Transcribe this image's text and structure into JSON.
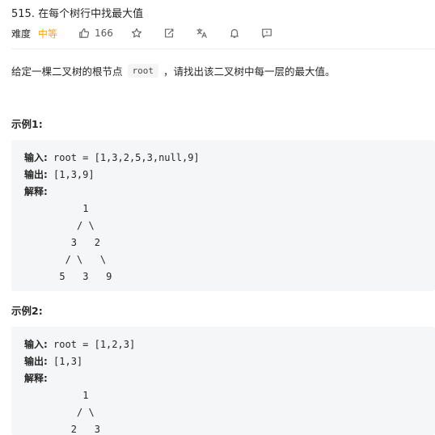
{
  "problem": {
    "title": "515. 在每个树行中找最大值",
    "difficulty_label": "难度",
    "difficulty_value": "中等",
    "like_count": "166"
  },
  "icons": {
    "like": "thumbs-up-icon",
    "favorite": "star-icon",
    "share": "share-icon",
    "translate": "translate-icon",
    "notify": "bell-icon",
    "feedback": "feedback-icon"
  },
  "description": {
    "prefix": "给定一棵二叉树的根节点",
    "code": "root",
    "suffix": "，请找出该二叉树中每一层的最大值。"
  },
  "examples": [
    {
      "title": "示例1:",
      "input_label": "输入:",
      "input_value": " root = [1,3,2,5,3,null,9]",
      "output_label": "输出:",
      "output_value": " [1,3,9]",
      "explain_label": "解释:",
      "tree": [
        "          1",
        "         / \\",
        "        3   2",
        "       / \\   \\",
        "      5   3   9"
      ]
    },
    {
      "title": "示例2:",
      "input_label": "输入:",
      "input_value": " root = [1,2,3]",
      "output_label": "输出:",
      "output_value": " [1,3]",
      "explain_label": "解释:",
      "tree": [
        "          1",
        "         / \\",
        "        2   3"
      ]
    }
  ],
  "colors": {
    "difficulty_medium": "#ffa116",
    "code_bg": "#f5f6f7",
    "text": "#262626"
  }
}
